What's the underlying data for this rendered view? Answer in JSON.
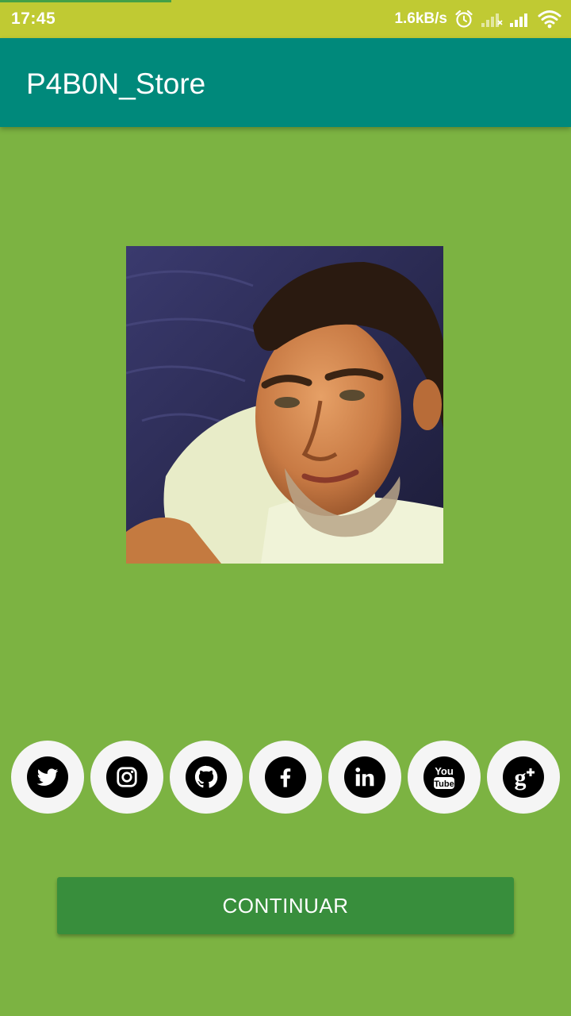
{
  "status_bar": {
    "time": "17:45",
    "net_speed": "1.6kB/s",
    "icons": [
      "alarm-icon",
      "sim1-signal-icon",
      "sim2-signal-icon",
      "wifi-icon"
    ]
  },
  "app_bar": {
    "title": "P4B0N_Store"
  },
  "profile": {
    "photo": "profile-photo"
  },
  "social": [
    {
      "name": "twitter-icon"
    },
    {
      "name": "instagram-icon"
    },
    {
      "name": "github-icon"
    },
    {
      "name": "facebook-icon"
    },
    {
      "name": "linkedin-icon"
    },
    {
      "name": "youtube-icon",
      "text": "You Tube"
    },
    {
      "name": "google-plus-icon",
      "text": "g+"
    }
  ],
  "button": {
    "label": "CONTINUAR"
  },
  "colors": {
    "status_bar": "#c0ca33",
    "app_bar": "#00897b",
    "background": "#7cb342",
    "button": "#388e3c",
    "icon_circle": "#f5f5f5"
  }
}
